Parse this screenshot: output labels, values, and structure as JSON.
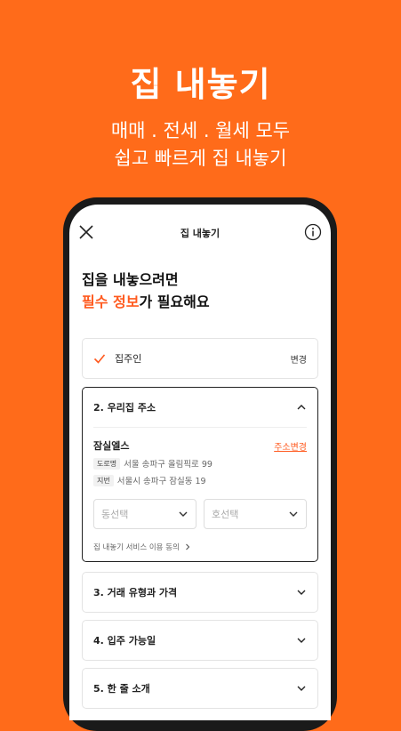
{
  "promo": {
    "title": "집 내놓기",
    "subtitle_line1": "매매 . 전세 . 월세 모두",
    "subtitle_line2": "쉽고 빠르게 집 내놓기"
  },
  "screen": {
    "topbar_title": "집 내놓기",
    "headline_line1": "집을 내놓으려면",
    "headline_accent": "필수 정보",
    "headline_rest": "가 필요해요"
  },
  "steps": {
    "owner": {
      "label": "집주인",
      "action": "변경"
    },
    "address": {
      "label": "2. 우리집 주소",
      "place_name": "잠실엘스",
      "change_label": "주소변경",
      "road_tag": "도로명",
      "road_addr": "서울 송파구 올림픽로 99",
      "jibun_tag": "지번",
      "jibun_addr": "서울시 송파구 잠실동 19",
      "dong_placeholder": "동선택",
      "ho_placeholder": "호선택",
      "consent_label": "집 내놓기 서비스 이용 동의"
    },
    "deal": {
      "label": "3. 거래 유형과 가격"
    },
    "movein": {
      "label": "4. 입주 가능일"
    },
    "intro": {
      "label": "5. 한 줄 소개"
    }
  },
  "colors": {
    "brand": "#FF6B1A",
    "accent": "#FF5A1F"
  }
}
